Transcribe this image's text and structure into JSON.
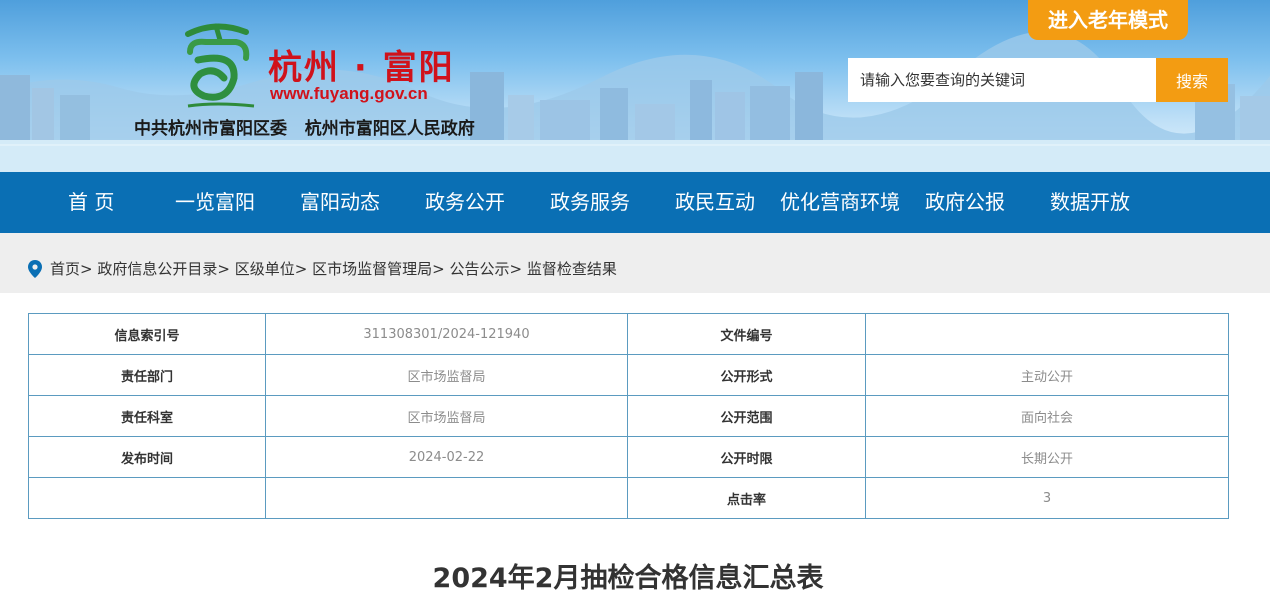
{
  "header": {
    "site_name": "杭州 · 富阳",
    "site_url": "www.fuyang.gov.cn",
    "org_line": "中共杭州市富阳区委   杭州市富阳区人民政府",
    "elder_mode_label": "进入老年模式",
    "search_placeholder": "请输入您要查询的关键词",
    "search_button": "搜索"
  },
  "nav": {
    "items": [
      "首 页",
      "一览富阳",
      "富阳动态",
      "政务公开",
      "政务服务",
      "政民互动",
      "优化营商环境",
      "政府公报",
      "数据开放"
    ]
  },
  "breadcrumb": {
    "items": [
      "首页",
      "政府信息公开目录",
      "区级单位",
      "区市场监督管理局",
      "公告公示",
      "监督检查结果"
    ],
    "separator": ">"
  },
  "info_table": {
    "rows": [
      {
        "k1": "信息索引号",
        "v1": "311308301/2024-121940",
        "k2": "文件编号",
        "v2": ""
      },
      {
        "k1": "责任部门",
        "v1": "区市场监督局",
        "k2": "公开形式",
        "v2": "主动公开"
      },
      {
        "k1": "责任科室",
        "v1": "区市场监督局",
        "k2": "公开范围",
        "v2": "面向社会"
      },
      {
        "k1": "发布时间",
        "v1": "2024-02-22",
        "k2": "公开时限",
        "v2": "长期公开"
      },
      {
        "k1": "",
        "v1": "",
        "k2": "点击率",
        "v2": "3"
      }
    ]
  },
  "document": {
    "title": "2024年2月抽检合格信息汇总表"
  },
  "colors": {
    "nav_bg": "#0a6fb4",
    "accent_orange": "#f39c12",
    "brand_red": "#d0121b",
    "table_border": "#5b9bc0"
  }
}
